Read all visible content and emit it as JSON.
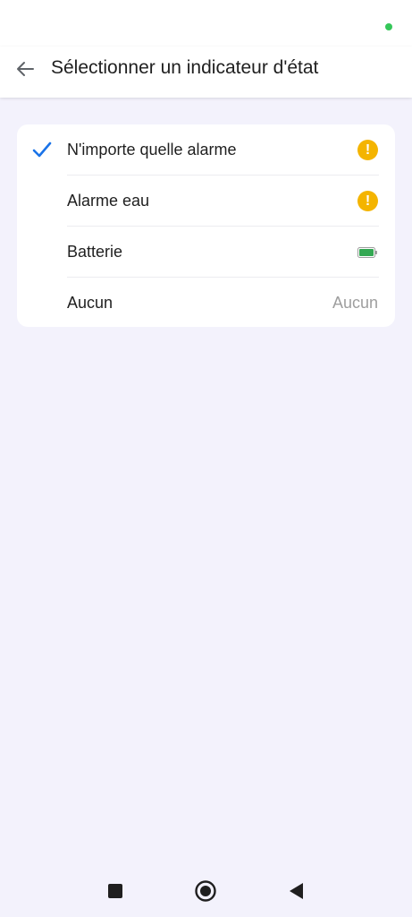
{
  "status_bar": {
    "indicator_color": "#35c759"
  },
  "header": {
    "back_icon": "arrow-left-icon",
    "title": "Sélectionner un indicateur d'état"
  },
  "options": [
    {
      "label": "N'importe quelle alarme",
      "selected": true,
      "trailing": "alert-icon"
    },
    {
      "label": "Alarme eau",
      "selected": false,
      "trailing": "alert-icon"
    },
    {
      "label": "Batterie",
      "selected": false,
      "trailing": "battery-icon"
    },
    {
      "label": "Aucun",
      "selected": false,
      "trailing_text": "Aucun"
    }
  ],
  "icons": {
    "alert_glyph": "!"
  },
  "colors": {
    "accent": "#1a73e8",
    "alert": "#f4b400",
    "battery": "#34a853",
    "background": "#f3f2fc"
  },
  "nav_bar": {
    "recents_icon": "square-icon",
    "home_icon": "circle-icon",
    "back_icon": "triangle-back-icon"
  }
}
